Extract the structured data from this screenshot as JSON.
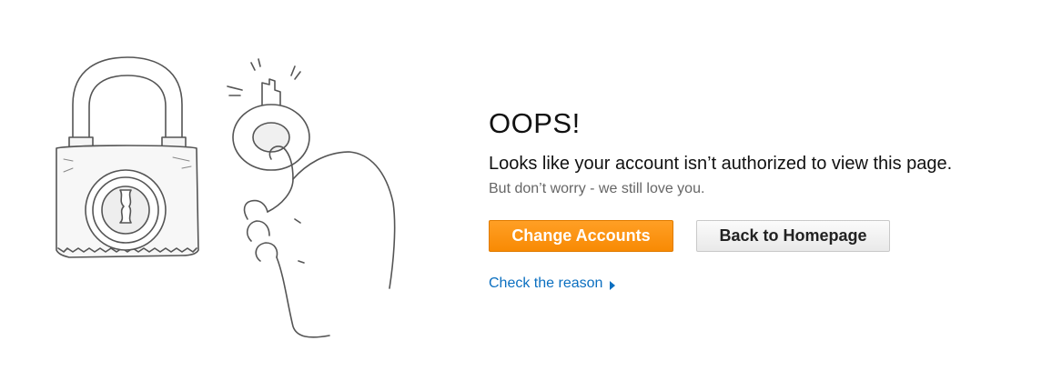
{
  "illustration": {
    "padlock_icon": "padlock-icon",
    "hand_key_icon": "hand-holding-key-icon"
  },
  "error": {
    "title": "OOPS!",
    "message": "Looks like your account isn’t authorized to view this page.",
    "submessage": "But don’t worry - we still love you."
  },
  "actions": {
    "primary_label": "Change Accounts",
    "secondary_label": "Back to Homepage",
    "link_label": "Check the reason",
    "link_icon": "arrow-right-icon"
  },
  "colors": {
    "primary_button": "#f88a04",
    "link": "#0b6fc0",
    "subtext": "#666666"
  }
}
